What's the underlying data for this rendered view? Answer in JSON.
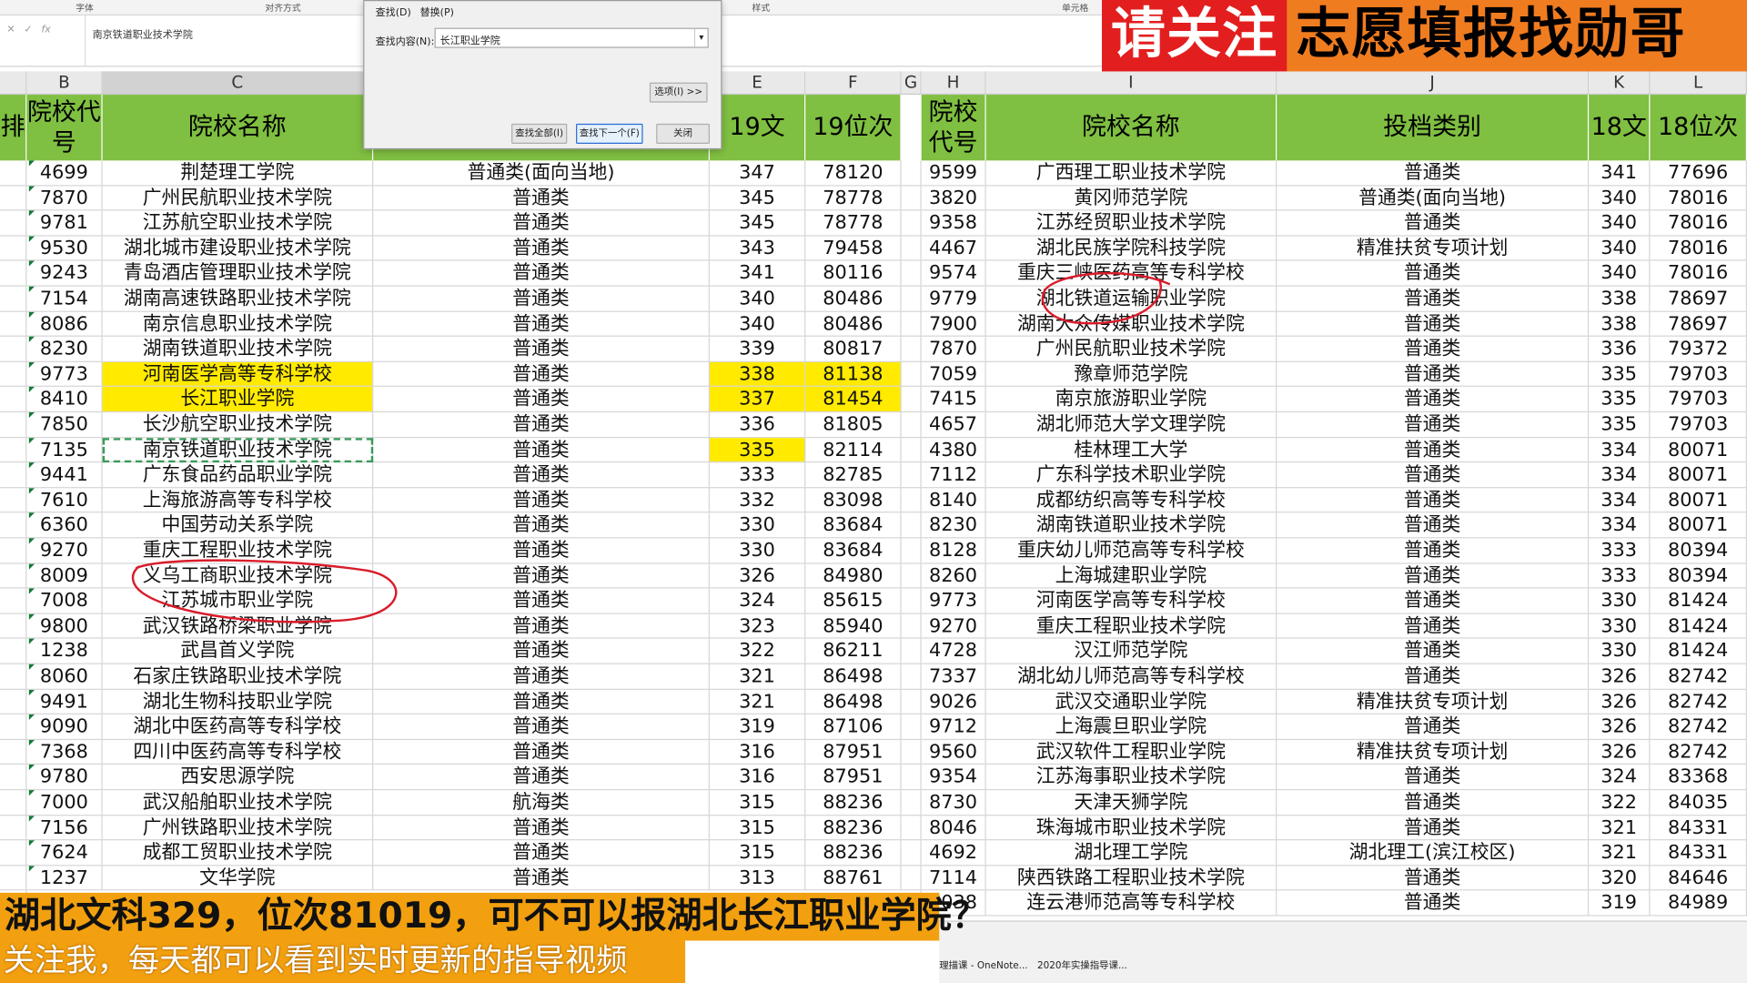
{
  "ribbon": {
    "font_group": "字体",
    "align_group": "对齐方式",
    "style_group": "样式",
    "cell_group": "单元格"
  },
  "formula_bar": {
    "value": "南京铁道职业技术学院"
  },
  "dialog": {
    "tab_find": "查找(D)",
    "tab_replace": "替换(P)",
    "find_label": "查找内容(N):",
    "find_value": "长江职业学院",
    "options_btn": "选项(I) >>",
    "find_all_btn": "查找全部(I)",
    "find_next_btn": "查找下一个(F)",
    "close_btn": "关闭"
  },
  "banner": {
    "part1": "请关注",
    "part2": "志愿填报找勋哥"
  },
  "column_letters": {
    "A": "",
    "B": "B",
    "C": "C",
    "D": "",
    "E": "E",
    "F": "F",
    "G": "G",
    "H": "H",
    "I": "I",
    "J": "J",
    "K": "K",
    "L": "L"
  },
  "headers": {
    "left_frag": "排",
    "code": "院校代号",
    "name": "院校名称",
    "score19": "19文",
    "rank19": "19位次",
    "code2": "院校代号",
    "name2": "院校名称",
    "type2": "投档类别",
    "score18": "18文",
    "rank18": "18位次"
  },
  "left_rows": [
    [
      "4699",
      "荆楚理工学院",
      "普通类(面向当地)",
      "347",
      "78120"
    ],
    [
      "7870",
      "广州民航职业技术学院",
      "普通类",
      "345",
      "78778"
    ],
    [
      "9781",
      "江苏航空职业技术学院",
      "普通类",
      "345",
      "78778"
    ],
    [
      "9530",
      "湖北城市建设职业技术学院",
      "普通类",
      "343",
      "79458"
    ],
    [
      "9243",
      "青岛酒店管理职业技术学院",
      "普通类",
      "341",
      "80116"
    ],
    [
      "7154",
      "湖南高速铁路职业技术学院",
      "普通类",
      "340",
      "80486"
    ],
    [
      "8086",
      "南京信息职业技术学院",
      "普通类",
      "340",
      "80486"
    ],
    [
      "8230",
      "湖南铁道职业技术学院",
      "普通类",
      "339",
      "80817"
    ],
    [
      "9773",
      "河南医学高等专科学校",
      "普通类",
      "338",
      "81138"
    ],
    [
      "8410",
      "长江职业学院",
      "普通类",
      "337",
      "81454"
    ],
    [
      "7850",
      "长沙航空职业技术学院",
      "普通类",
      "336",
      "81805"
    ],
    [
      "7135",
      "南京铁道职业技术学院",
      "普通类",
      "335",
      "82114"
    ],
    [
      "9441",
      "广东食品药品职业学院",
      "普通类",
      "333",
      "82785"
    ],
    [
      "7610",
      "上海旅游高等专科学校",
      "普通类",
      "332",
      "83098"
    ],
    [
      "6360",
      "中国劳动关系学院",
      "普通类",
      "330",
      "83684"
    ],
    [
      "9270",
      "重庆工程职业技术学院",
      "普通类",
      "330",
      "83684"
    ],
    [
      "8009",
      "义乌工商职业技术学院",
      "普通类",
      "326",
      "84980"
    ],
    [
      "7008",
      "江苏城市职业学院",
      "普通类",
      "324",
      "85615"
    ],
    [
      "9800",
      "武汉铁路桥梁职业学院",
      "普通类",
      "323",
      "85940"
    ],
    [
      "1238",
      "武昌首义学院",
      "普通类",
      "322",
      "86211"
    ],
    [
      "8060",
      "石家庄铁路职业技术学院",
      "普通类",
      "321",
      "86498"
    ],
    [
      "9491",
      "湖北生物科技职业学院",
      "普通类",
      "321",
      "86498"
    ],
    [
      "9090",
      "湖北中医药高等专科学校",
      "普通类",
      "319",
      "87106"
    ],
    [
      "7368",
      "四川中医药高等专科学校",
      "普通类",
      "316",
      "87951"
    ],
    [
      "9780",
      "西安思源学院",
      "普通类",
      "316",
      "87951"
    ],
    [
      "7000",
      "武汉船舶职业技术学院",
      "航海类",
      "315",
      "88236"
    ],
    [
      "7156",
      "广州铁路职业技术学院",
      "普通类",
      "315",
      "88236"
    ],
    [
      "7624",
      "成都工贸职业技术学院",
      "普通类",
      "315",
      "88236"
    ],
    [
      "1237",
      "文华学院",
      "普通类",
      "313",
      "88761"
    ]
  ],
  "right_rows": [
    [
      "9599",
      "广西理工职业技术学院",
      "普通类",
      "341",
      "77696"
    ],
    [
      "3820",
      "黄冈师范学院",
      "普通类(面向当地)",
      "340",
      "78016"
    ],
    [
      "9358",
      "江苏经贸职业技术学院",
      "普通类",
      "340",
      "78016"
    ],
    [
      "4467",
      "湖北民族学院科技学院",
      "精准扶贫专项计划",
      "340",
      "78016"
    ],
    [
      "9574",
      "重庆三峡医药高等专科学校",
      "普通类",
      "340",
      "78016"
    ],
    [
      "9779",
      "湖北铁道运输职业学院",
      "普通类",
      "338",
      "78697"
    ],
    [
      "7900",
      "湖南大众传媒职业技术学院",
      "普通类",
      "338",
      "78697"
    ],
    [
      "7870",
      "广州民航职业技术学院",
      "普通类",
      "336",
      "79372"
    ],
    [
      "7059",
      "豫章师范学院",
      "普通类",
      "335",
      "79703"
    ],
    [
      "7415",
      "南京旅游职业学院",
      "普通类",
      "335",
      "79703"
    ],
    [
      "4657",
      "湖北师范大学文理学院",
      "普通类",
      "335",
      "79703"
    ],
    [
      "4380",
      "桂林理工大学",
      "普通类",
      "334",
      "80071"
    ],
    [
      "7112",
      "广东科学技术职业学院",
      "普通类",
      "334",
      "80071"
    ],
    [
      "8140",
      "成都纺织高等专科学校",
      "普通类",
      "334",
      "80071"
    ],
    [
      "8230",
      "湖南铁道职业技术学院",
      "普通类",
      "334",
      "80071"
    ],
    [
      "8128",
      "重庆幼儿师范高等专科学校",
      "普通类",
      "333",
      "80394"
    ],
    [
      "8260",
      "上海城建职业学院",
      "普通类",
      "333",
      "80394"
    ],
    [
      "9773",
      "河南医学高等专科学校",
      "普通类",
      "330",
      "81424"
    ],
    [
      "9270",
      "重庆工程职业技术学院",
      "普通类",
      "330",
      "81424"
    ],
    [
      "4728",
      "汉江师范学院",
      "普通类",
      "330",
      "81424"
    ],
    [
      "7337",
      "湖北幼儿师范高等专科学校",
      "普通类",
      "326",
      "82742"
    ],
    [
      "9026",
      "武汉交通职业学院",
      "精准扶贫专项计划",
      "326",
      "82742"
    ],
    [
      "9712",
      "上海震旦职业学院",
      "普通类",
      "326",
      "82742"
    ],
    [
      "9560",
      "武汉软件工程职业学院",
      "精准扶贫专项计划",
      "326",
      "82742"
    ],
    [
      "9354",
      "江苏海事职业技术学院",
      "普通类",
      "324",
      "83368"
    ],
    [
      "8730",
      "天津天狮学院",
      "普通类",
      "322",
      "84035"
    ],
    [
      "8046",
      "珠海城市职业技术学院",
      "普通类",
      "321",
      "84331"
    ],
    [
      "4692",
      "湖北理工学院",
      "湖北理工(滨江校区)",
      "321",
      "84331"
    ],
    [
      "7114",
      "陕西铁路工程职业技术学院",
      "普通类",
      "320",
      "84646"
    ],
    [
      "7038",
      "连云港师范高等专科学校",
      "普通类",
      "319",
      "84989"
    ]
  ],
  "highlight": {
    "color": "#ffea00",
    "rows_name": [
      8,
      9
    ],
    "score_rows": [
      8,
      9,
      11
    ],
    "dashed_row": 11
  },
  "captions": {
    "line1": "湖北文科329，位次81019，可不可以报湖北长江职业学院？",
    "line2": "关注我，每天都可以看到实时更新的指导视频"
  },
  "taskbar": {
    "app1": "理描课 - OneNote...",
    "app2": "2020年实操指导课..."
  }
}
